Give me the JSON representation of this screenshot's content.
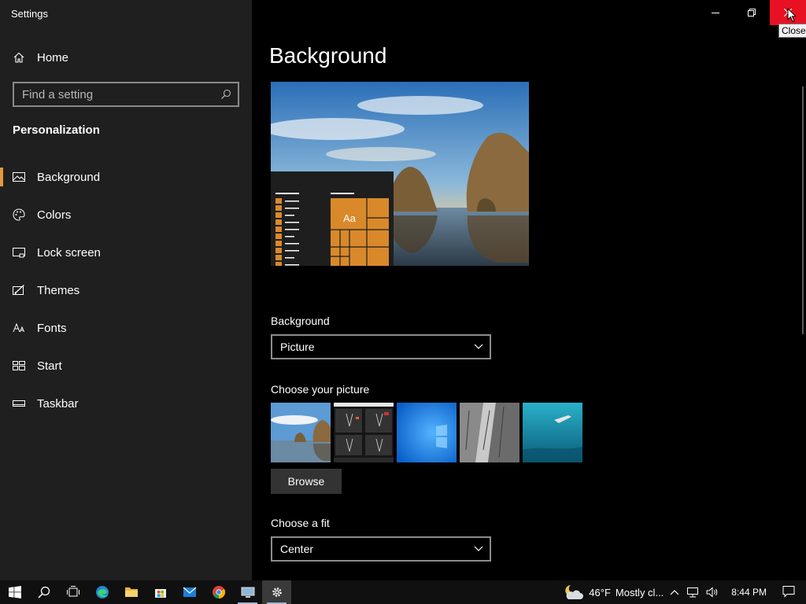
{
  "window": {
    "title": "Settings",
    "close_tooltip": "Close"
  },
  "sidebar": {
    "home_label": "Home",
    "search_placeholder": "Find a setting",
    "section_title": "Personalization",
    "items": [
      {
        "label": "Background",
        "icon": "picture-icon",
        "active": true
      },
      {
        "label": "Colors",
        "icon": "palette-icon"
      },
      {
        "label": "Lock screen",
        "icon": "lock-screen-icon"
      },
      {
        "label": "Themes",
        "icon": "themes-icon"
      },
      {
        "label": "Fonts",
        "icon": "fonts-icon"
      },
      {
        "label": "Start",
        "icon": "start-icon"
      },
      {
        "label": "Taskbar",
        "icon": "taskbar-icon"
      }
    ]
  },
  "main": {
    "page_title": "Background",
    "preview": {
      "tile_text": "Aa",
      "accent": "#d9892a"
    },
    "background_label": "Background",
    "background_value": "Picture",
    "choose_picture_label": "Choose your picture",
    "thumbnails": [
      "beach-rocks",
      "dark-screenshot",
      "windows-blue",
      "rock-cliff",
      "underwater-swimmer"
    ],
    "browse_label": "Browse",
    "fit_label": "Choose a fit",
    "fit_value": "Center"
  },
  "taskbar": {
    "apps": [
      "start-button",
      "search",
      "task-view",
      "edge",
      "file-explorer",
      "store",
      "mail",
      "chrome",
      "remote-desktop",
      "settings"
    ],
    "weather_temp": "46°F",
    "weather_text": "Mostly cl...",
    "time": "8:44 PM"
  },
  "colors": {
    "accent": "#e29a3b",
    "close_red": "#e81123",
    "sidebar_bg": "#1f1f1f"
  }
}
